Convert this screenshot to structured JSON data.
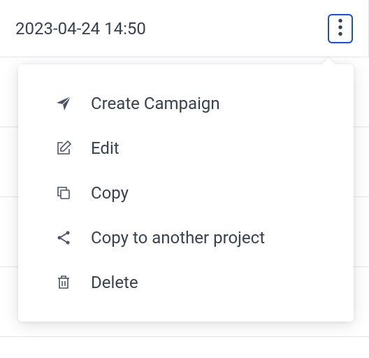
{
  "header": {
    "timestamp": "2023-04-24 14:50"
  },
  "menu": {
    "items": [
      {
        "label": "Create Campaign"
      },
      {
        "label": "Edit"
      },
      {
        "label": "Copy"
      },
      {
        "label": "Copy to another project"
      },
      {
        "label": "Delete"
      }
    ]
  }
}
